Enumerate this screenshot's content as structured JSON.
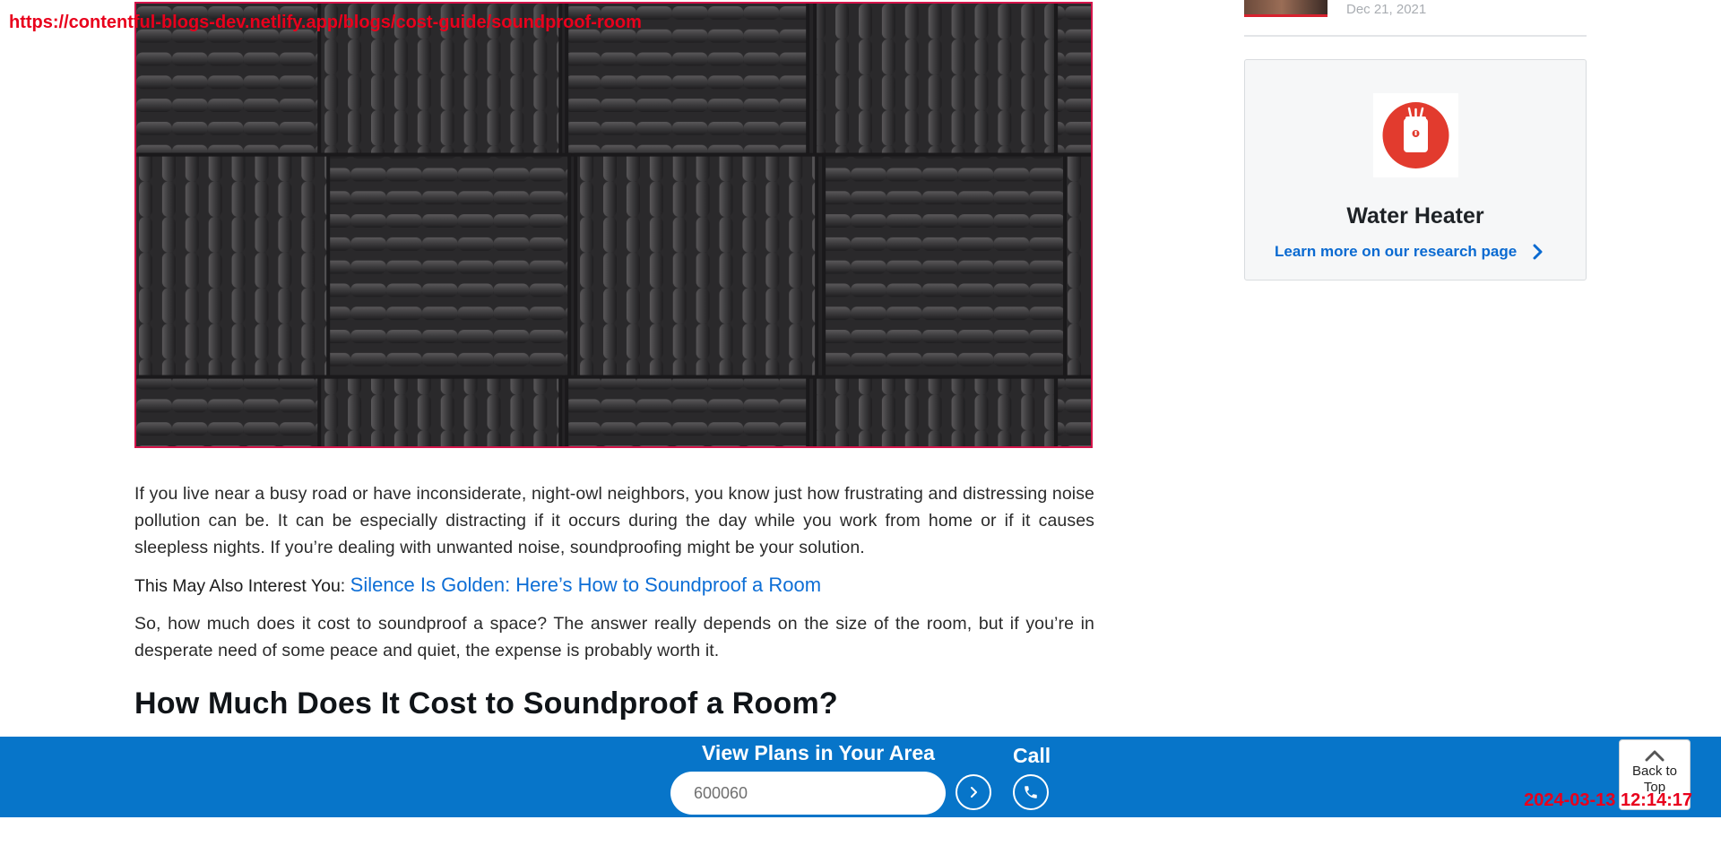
{
  "overlay": {
    "url": "https://contentful-blogs-dev.netlify.app/blogs/cost-guide/soundproof-room",
    "timestamp": "2024-03-13 12:14:17"
  },
  "article": {
    "paragraph1": "If you live near a busy road or have inconsiderate, night-owl neighbors, you know just how frustrating and distressing noise pollution can be. It can be especially distracting if it occurs during the day while you work from home or if it causes sleepless nights. If you’re dealing with unwanted noise, soundproofing might be your solution.",
    "interest_label": "This May Also Interest You:",
    "interest_link": "Silence Is Golden: Here’s How to Soundproof a Room",
    "paragraph2": "So, how much does it cost to soundproof a space? The answer really depends on the size of the room, but if you’re in desperate need of some peace and quiet, the expense is probably worth it.",
    "heading": "How Much Does It Cost to Soundproof a Room?"
  },
  "sidebar": {
    "recent_date": "Dec 21, 2021",
    "card": {
      "icon": "water-heater-icon",
      "title": "Water Heater",
      "link_label": "Learn more on our research page"
    }
  },
  "bottom_bar": {
    "title": "View Plans in Your Area",
    "zip_value": "600060",
    "call_label": "Call",
    "back_to_top": "Back to Top"
  },
  "colors": {
    "brand_blue": "#0775c9",
    "link_blue": "#0a6ad1",
    "accent_red": "#e23b2e"
  }
}
